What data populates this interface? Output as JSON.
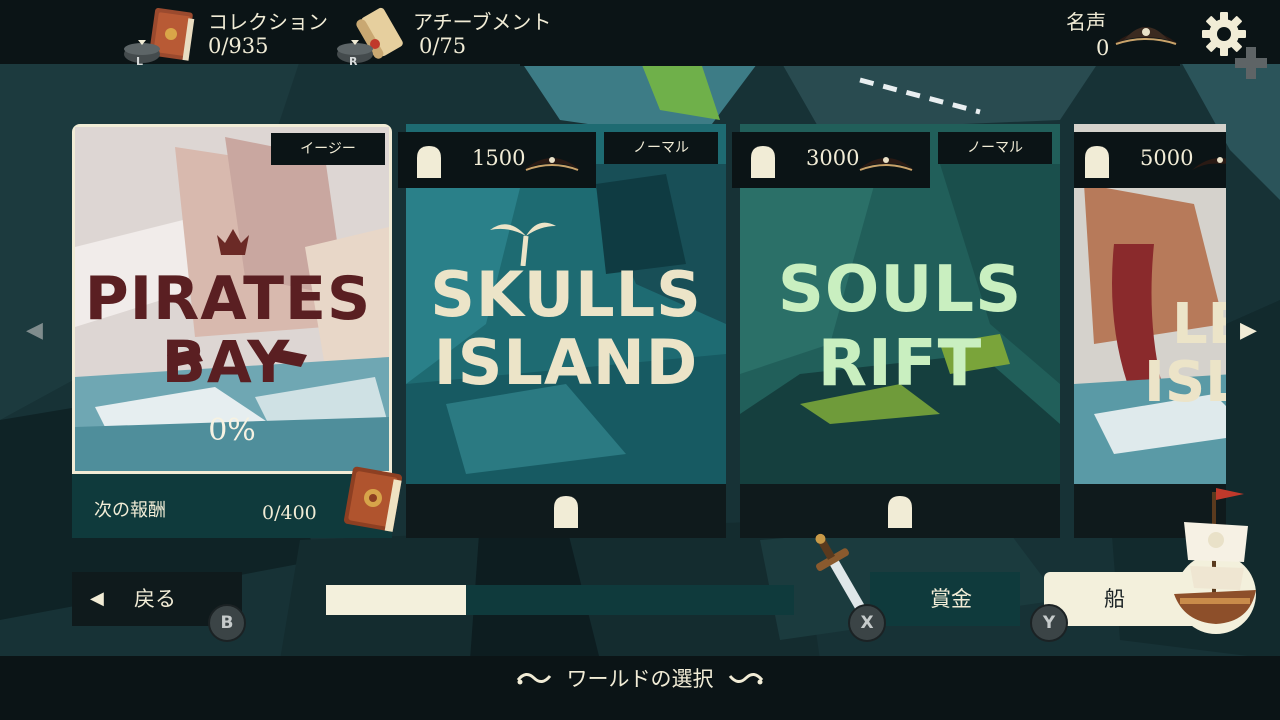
{
  "hud": {
    "collection": {
      "label": "コレクション",
      "value": "0/935",
      "shoulder": "L",
      "icon": "book-icon"
    },
    "achievement": {
      "label": "アチーブメント",
      "value": "0/75",
      "shoulder": "R",
      "icon": "scroll-icon"
    },
    "fame": {
      "label": "名声",
      "value": "0",
      "icon": "pirate-hat-icon"
    },
    "settings_icon": "gear-icon"
  },
  "worlds": [
    {
      "title_line1": "PIRATES",
      "title_line2": "BAY",
      "difficulty": "イージー",
      "progress": "0%",
      "locked": false,
      "reward_label": "次の報酬",
      "reward_value": "0/400",
      "colors": {
        "title": "#5a1f22",
        "sky": "#d9d3cf"
      }
    },
    {
      "title_line1": "SKULLS",
      "title_line2": "ISLAND",
      "difficulty": "ノーマル",
      "cost": "1500",
      "locked": true,
      "colors": {
        "title": "#ece4c8",
        "sky": "#1f6f76"
      }
    },
    {
      "title_line1": "SOULS",
      "title_line2": "RIFT",
      "difficulty": "ノーマル",
      "cost": "3000",
      "locked": true,
      "colors": {
        "title": "#c9efc0",
        "sky": "#1f5f5a"
      }
    },
    {
      "title_line1": "LE",
      "title_line2": "ISLA",
      "cost": "5000",
      "locked": true,
      "colors": {
        "title": "#ece4c8",
        "sky": "#d9d6d0"
      }
    }
  ],
  "progress_bar": {
    "fraction": 0.3
  },
  "buttons": {
    "back": {
      "label": "戻る",
      "pad": "B"
    },
    "bounty": {
      "label": "賞金",
      "pad": "X"
    },
    "ship": {
      "label": "船",
      "pad": "Y"
    }
  },
  "screen_title": "ワールドの選択",
  "colors": {
    "accent": "#f1ecd6",
    "panel": "#0b1416",
    "teal": "#0f3a3c"
  }
}
